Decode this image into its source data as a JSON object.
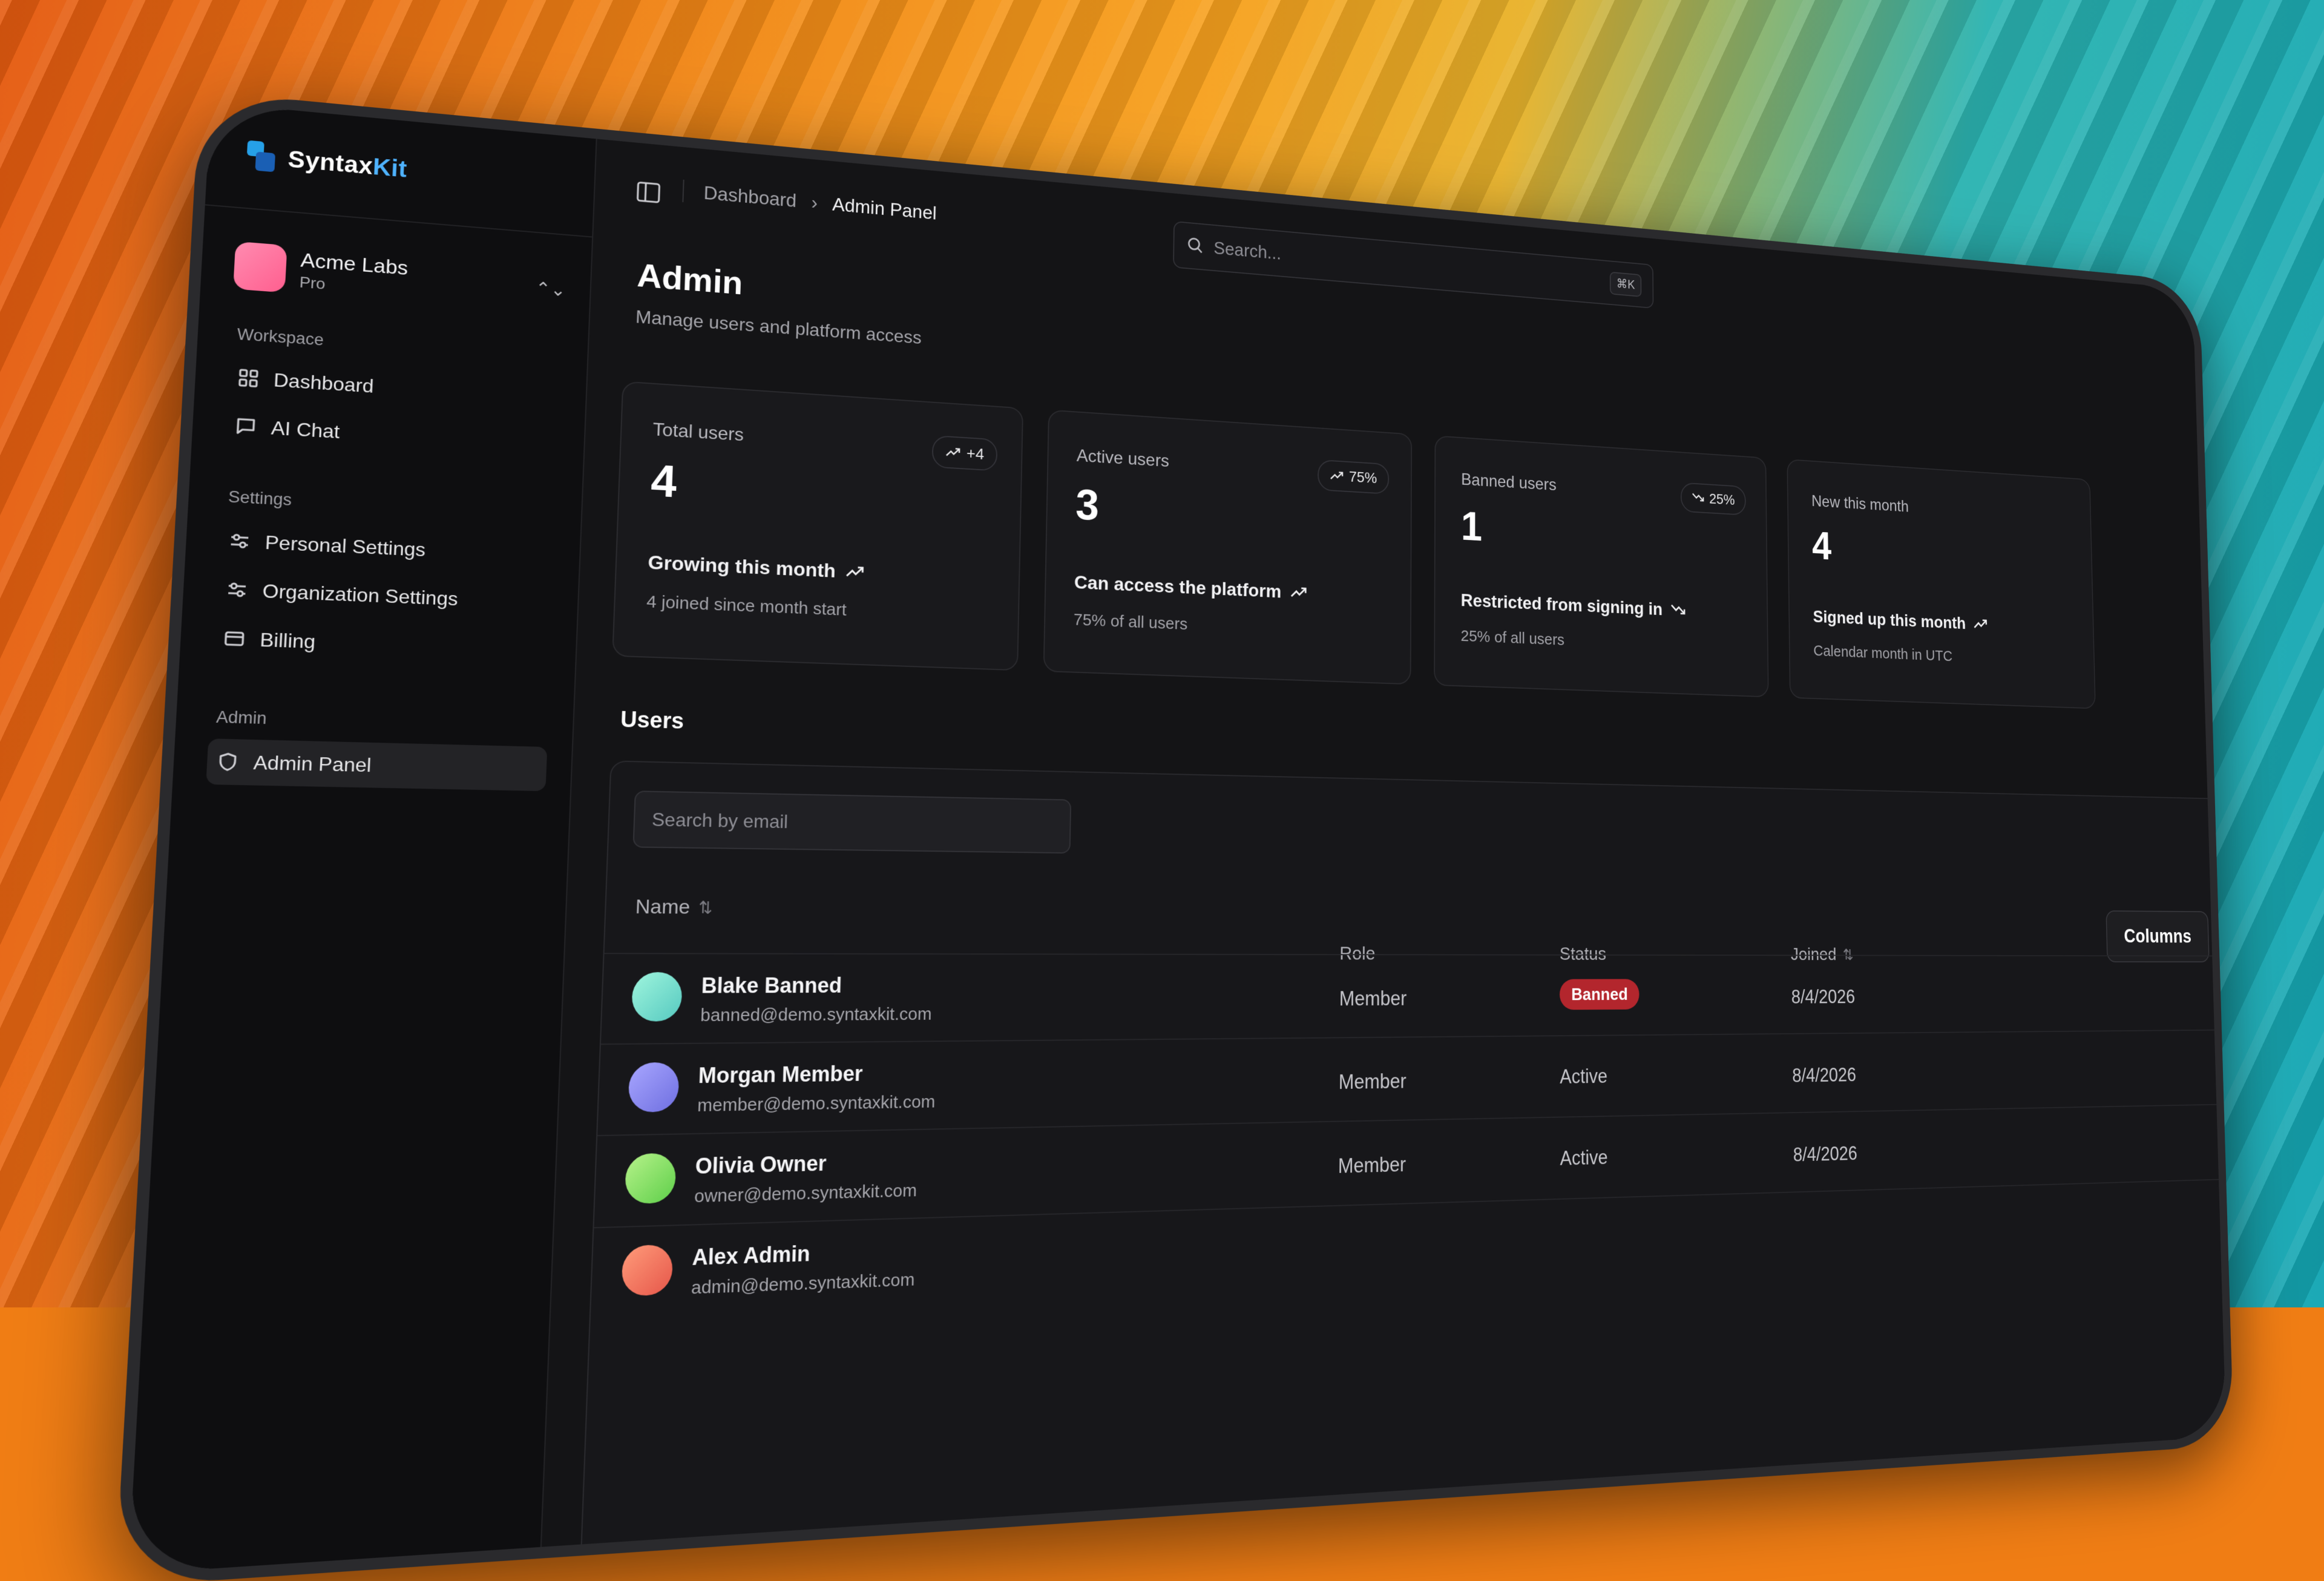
{
  "app": {
    "logo_main": "Syntax",
    "logo_accent": "Kit"
  },
  "organization": {
    "name": "Acme Labs",
    "plan": "Pro"
  },
  "sidebar": {
    "sections": [
      {
        "title": "Workspace",
        "items": [
          {
            "label": "Dashboard",
            "icon": "grid-icon"
          },
          {
            "label": "AI Chat",
            "icon": "chat-icon"
          }
        ]
      },
      {
        "title": "Settings",
        "items": [
          {
            "label": "Personal Settings",
            "icon": "sliders-icon"
          },
          {
            "label": "Organization Settings",
            "icon": "sliders-icon"
          },
          {
            "label": "Billing",
            "icon": "card-icon"
          }
        ]
      },
      {
        "title": "Admin",
        "items": [
          {
            "label": "Admin Panel",
            "icon": "shield-icon",
            "active": true
          }
        ]
      }
    ]
  },
  "header": {
    "breadcrumbs": [
      "Dashboard",
      "Admin Panel"
    ],
    "search_placeholder": "Search...",
    "search_shortcut": "⌘K"
  },
  "page": {
    "title": "Admin",
    "subtitle": "Manage users and platform access"
  },
  "stats": [
    {
      "label": "Total users",
      "value": "4",
      "badge": "+4",
      "trend": "up",
      "headline": "Growing this month",
      "detail": "4 joined since month start"
    },
    {
      "label": "Active users",
      "value": "3",
      "badge": "75%",
      "trend": "up",
      "headline": "Can access the platform",
      "detail": "75% of all users"
    },
    {
      "label": "Banned users",
      "value": "1",
      "badge": "25%",
      "trend": "down",
      "headline": "Restricted from signing in",
      "detail": "25% of all users"
    },
    {
      "label": "New this month",
      "value": "4",
      "badge": "",
      "trend": "up",
      "headline": "Signed up this month",
      "detail": "Calendar month in UTC"
    }
  ],
  "users_section": {
    "title": "Users",
    "search_placeholder": "Search by email",
    "columns_button": "Columns",
    "headers": {
      "name": "Name",
      "role": "Role",
      "status": "Status",
      "joined": "Joined"
    },
    "rows": [
      {
        "name": "Blake Banned",
        "email": "banned@demo.syntaxkit.com",
        "role": "Member",
        "status": "Banned",
        "joined": "8/4/2026",
        "avatar_color": "#7fe3c9"
      },
      {
        "name": "Morgan Member",
        "email": "member@demo.syntaxkit.com",
        "role": "Member",
        "status": "Active",
        "joined": "8/4/2026",
        "avatar_color": "#8f8cf0"
      },
      {
        "name": "Olivia Owner",
        "email": "owner@demo.syntaxkit.com",
        "role": "Member",
        "status": "Active",
        "joined": "8/4/2026",
        "avatar_color": "#8fe06a"
      },
      {
        "name": "Alex Admin",
        "email": "admin@demo.syntaxkit.com",
        "role": "",
        "status": "",
        "joined": "",
        "avatar_color": "#f07a5c"
      }
    ]
  },
  "colors": {
    "accent": "#4fb3ff",
    "banned": "#b3262d",
    "background": "#141416"
  }
}
